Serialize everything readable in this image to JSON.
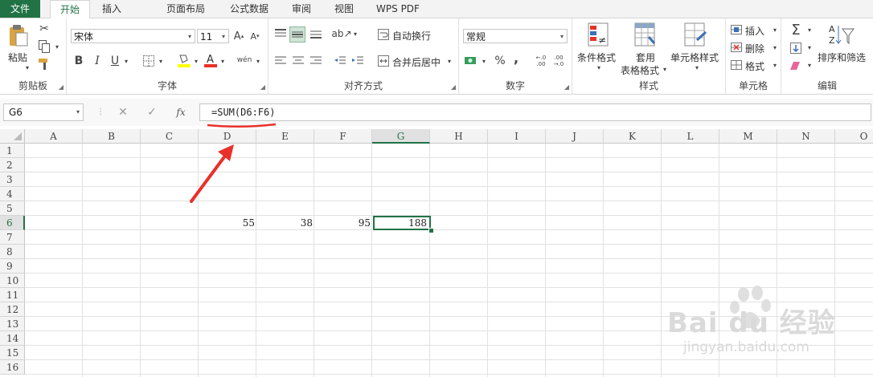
{
  "tabs": [
    {
      "label": "文件",
      "active": false
    },
    {
      "label": "开始",
      "active": true
    },
    {
      "label": "插入",
      "active": false
    },
    {
      "label": "页面布局",
      "active": false
    },
    {
      "label": "公式",
      "active": false
    },
    {
      "label": "数据",
      "active": false
    },
    {
      "label": "审阅",
      "active": false
    },
    {
      "label": "视图",
      "active": false
    },
    {
      "label": "WPS PDF",
      "active": false
    }
  ],
  "ribbon": {
    "clipboard": {
      "paste": "粘贴",
      "group": "剪贴板"
    },
    "font": {
      "name": "宋体",
      "size": "11",
      "bold": "B",
      "italic": "I",
      "underline": "U",
      "group": "字体"
    },
    "align": {
      "wrap": "自动换行",
      "merge": "合并后居中",
      "group": "对齐方式"
    },
    "number": {
      "format": "常规",
      "percent": "%",
      "comma": ",",
      "group": "数字"
    },
    "styles": {
      "cond": "条件格式",
      "table_a": "套用",
      "table_b": "表格格式",
      "cellstyle": "单元格样式",
      "group": "样式"
    },
    "cells": {
      "insert": "插入",
      "delete": "删除",
      "format": "格式",
      "group": "单元格"
    },
    "editing": {
      "sort": "排序和筛选",
      "group": "编辑"
    }
  },
  "formula_bar": {
    "name_box": "G6",
    "fx": "fx",
    "formula": "=SUM(D6:F6)"
  },
  "sheet": {
    "columns": [
      "A",
      "B",
      "C",
      "D",
      "E",
      "F",
      "G",
      "H",
      "I",
      "J",
      "K",
      "L",
      "M",
      "N",
      "O"
    ],
    "rows": [
      "1",
      "2",
      "3",
      "4",
      "5",
      "6",
      "7",
      "8",
      "9",
      "10",
      "11",
      "12",
      "13",
      "14",
      "15",
      "16"
    ],
    "selected_col": "G",
    "selected_row": "6",
    "cells": {
      "D6": "55",
      "E6": "38",
      "F6": "95",
      "G6": "188"
    }
  },
  "annotation_colors": {
    "arrow": "#e8312a",
    "underline": "#e8312a",
    "accent": "#217346"
  },
  "watermark": {
    "brand": "Bai du 经验",
    "url": "jingyan.baidu.com"
  }
}
